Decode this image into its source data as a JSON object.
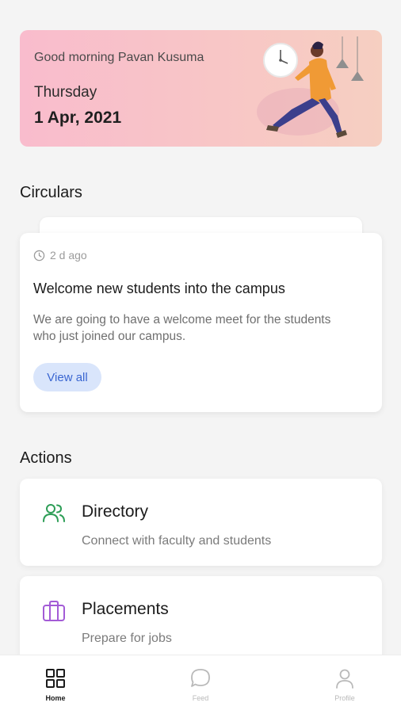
{
  "hero": {
    "greeting": "Good morning Pavan Kusuma",
    "day": "Thursday",
    "date": "1 Apr, 2021"
  },
  "circulars": {
    "title": "Circulars",
    "card": {
      "time_ago": "2 d ago",
      "title": "Welcome new students into the campus",
      "body": "We are going to have a welcome meet for the students who just joined our campus.",
      "button_label": "View all"
    }
  },
  "actions": {
    "title": "Actions",
    "items": [
      {
        "title": "Directory",
        "subtitle": "Connect with faculty and students",
        "icon": "users-icon",
        "color": "#2e9e57"
      },
      {
        "title": "Placements",
        "subtitle": "Prepare for jobs",
        "icon": "briefcase-icon",
        "color": "#a35bd6"
      }
    ]
  },
  "nav": {
    "items": [
      {
        "label": "Home",
        "icon": "grid-icon",
        "active": true
      },
      {
        "label": "Feed",
        "icon": "chat-bubble-icon",
        "active": false
      },
      {
        "label": "Profile",
        "icon": "person-icon",
        "active": false
      }
    ]
  },
  "colors": {
    "hero_gradient_start": "#f9bccd",
    "hero_gradient_end": "#f6cfc1",
    "accent_blue": "#3a66d1",
    "button_bg": "#d9e5fb"
  }
}
